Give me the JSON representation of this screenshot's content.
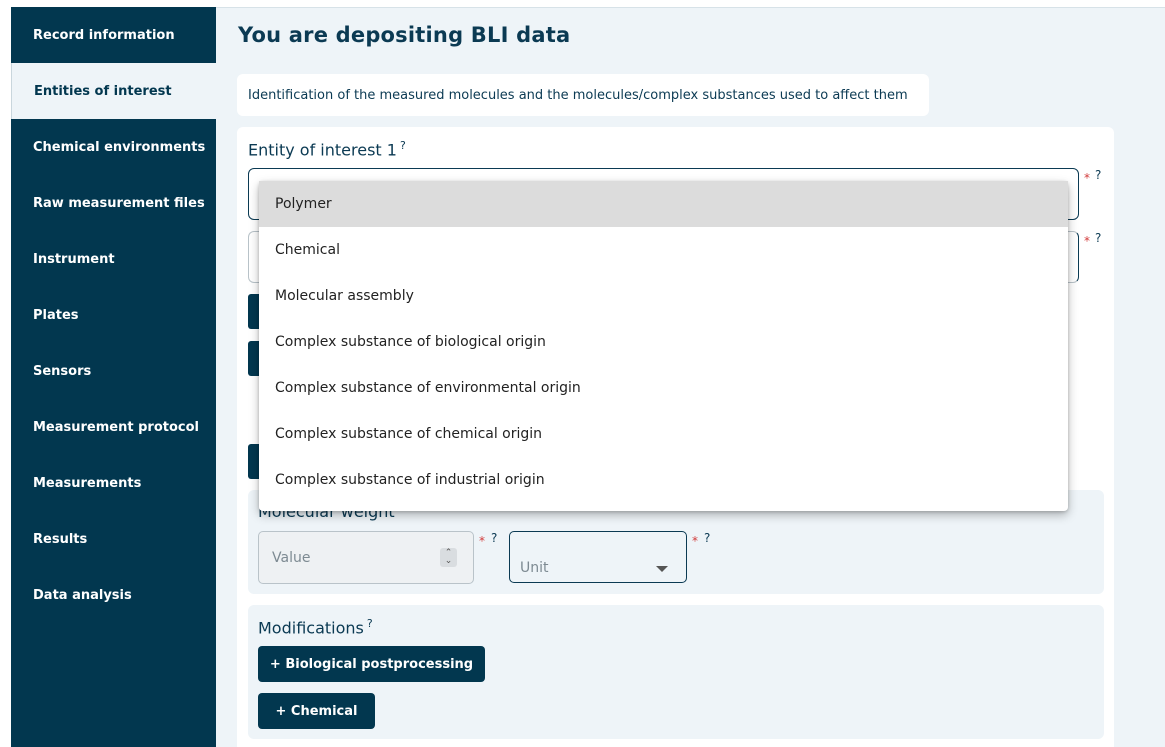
{
  "sidebar": {
    "items": [
      {
        "label": "Record information",
        "active": false
      },
      {
        "label": "Entities of interest",
        "active": true
      },
      {
        "label": "Chemical environments",
        "active": false
      },
      {
        "label": "Raw measurement files",
        "active": false
      },
      {
        "label": "Instrument",
        "active": false
      },
      {
        "label": "Plates",
        "active": false
      },
      {
        "label": "Sensors",
        "active": false
      },
      {
        "label": "Measurement protocol",
        "active": false
      },
      {
        "label": "Measurements",
        "active": false
      },
      {
        "label": "Results",
        "active": false
      },
      {
        "label": "Data analysis",
        "active": false
      }
    ]
  },
  "main": {
    "title": "You are depositing BLI data",
    "intro": "Identification of the measured molecules and the molecules/complex substances used to affect them",
    "entity": {
      "title": "Entity of interest 1",
      "help": "?",
      "required_mark": "*",
      "help_mark": "?"
    },
    "molecular_weight": {
      "title": "Molecular weight",
      "value_placeholder": "Value",
      "unit_placeholder": "Unit"
    },
    "modifications": {
      "title": "Modifications",
      "help": "?",
      "buttons": [
        "+ Biological postprocessing",
        "+ Chemical"
      ]
    }
  },
  "dropdown": {
    "options": [
      "Polymer",
      "Chemical",
      "Molecular assembly",
      "Complex substance of biological origin",
      "Complex substance of environmental origin",
      "Complex substance of chemical origin",
      "Complex substance of industrial origin"
    ],
    "highlighted": "Polymer"
  },
  "colors": {
    "sidebar_bg": "#02374f",
    "accent": "#0b3a53",
    "page_bg": "#eef4f8",
    "required": "#d23b3b"
  }
}
